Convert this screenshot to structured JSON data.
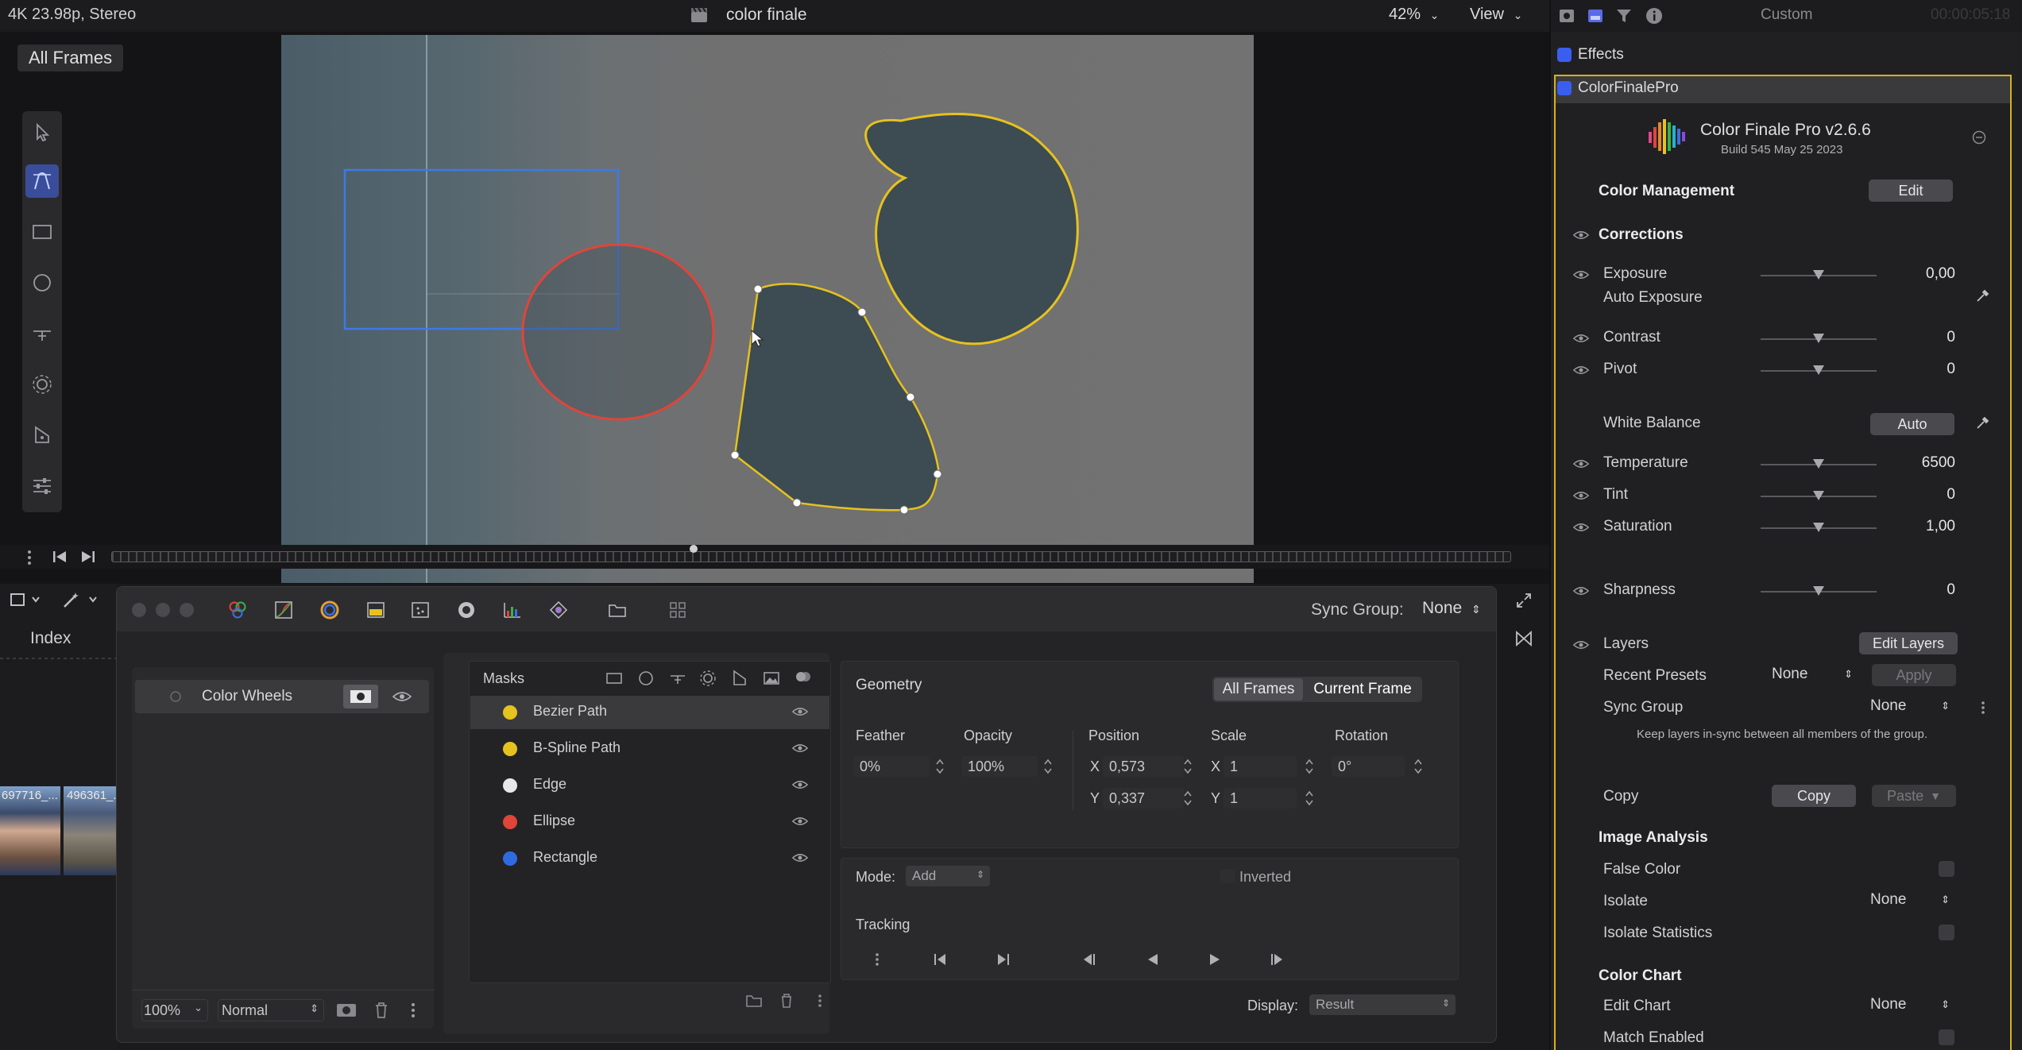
{
  "viewer": {
    "format": "4K 23.98p, Stereo",
    "clip_title": "color finale",
    "zoom": "42%",
    "view_menu": "View",
    "all_frames_badge": "All Frames"
  },
  "inspector_header": {
    "preset": "Custom",
    "timecode": "00:00:05:18"
  },
  "colors": {
    "accent_blue": "#3a5ef0",
    "mask_yellow": "#e6c21e",
    "mask_white": "#e8e8e8",
    "mask_red": "#e0453a",
    "mask_blue": "#2f6be0",
    "selection_yellow": "#d6b21a"
  },
  "bottom_toolbar": {
    "sync_group_label": "Sync Group:",
    "sync_group_value": "None"
  },
  "browser": {
    "index_tab": "Index",
    "thumb1_label": "697716_...",
    "thumb2_label": "496361_..."
  },
  "layers_panel": {
    "layer_name": "Color Wheels",
    "zoom_value": "100%",
    "blend_mode": "Normal"
  },
  "masks": {
    "title": "Masks",
    "items": [
      {
        "label": "Bezier Path",
        "color": "#e6c21e"
      },
      {
        "label": "B-Spline Path",
        "color": "#e6c21e"
      },
      {
        "label": "Edge",
        "color": "#e8e8e8"
      },
      {
        "label": "Ellipse",
        "color": "#e0453a"
      },
      {
        "label": "Rectangle",
        "color": "#2f6be0"
      }
    ]
  },
  "geometry": {
    "title": "Geometry",
    "all_frames": "All Frames",
    "current_frame": "Current Frame",
    "feather_label": "Feather",
    "feather_value": "0%",
    "opacity_label": "Opacity",
    "opacity_value": "100%",
    "position_label": "Position",
    "pos_x_label": "X",
    "pos_x": "0,573",
    "pos_y_label": "Y",
    "pos_y": "0,337",
    "scale_label": "Scale",
    "scale_x_label": "X",
    "scale_x": "1",
    "scale_y_label": "Y",
    "scale_y": "1",
    "rotation_label": "Rotation",
    "rotation_value": "0°",
    "mode_label": "Mode:",
    "mode_value": "Add",
    "inverted_label": "Inverted",
    "tracking_label": "Tracking",
    "display_label": "Display:",
    "display_value": "Result"
  },
  "inspector": {
    "effects_label": "Effects",
    "plugin_label": "ColorFinalePro",
    "product_name": "Color Finale Pro v2.6.6",
    "build": "Build 545 May 25 2023",
    "color_management": "Color Management",
    "edit_button": "Edit",
    "corrections": "Corrections",
    "exposure_label": "Exposure",
    "exposure_value": "0,00",
    "auto_exposure_label": "Auto Exposure",
    "contrast_label": "Contrast",
    "contrast_value": "0",
    "pivot_label": "Pivot",
    "pivot_value": "0",
    "white_balance_label": "White Balance",
    "auto_button": "Auto",
    "temperature_label": "Temperature",
    "temperature_value": "6500",
    "tint_label": "Tint",
    "tint_value": "0",
    "saturation_label": "Saturation",
    "saturation_value": "1,00",
    "sharpness_label": "Sharpness",
    "sharpness_value": "0",
    "layers_label": "Layers",
    "edit_layers_button": "Edit Layers",
    "recent_presets_label": "Recent Presets",
    "recent_presets_value": "None",
    "apply_button": "Apply",
    "sync_group_label": "Sync Group",
    "sync_group_value": "None",
    "sync_note": "Keep layers in-sync between all members of the group.",
    "copy_label": "Copy",
    "copy_button": "Copy",
    "paste_button": "Paste",
    "image_analysis": "Image Analysis",
    "false_color_label": "False Color",
    "isolate_label": "Isolate",
    "isolate_value": "None",
    "isolate_stats_label": "Isolate Statistics",
    "color_chart": "Color Chart",
    "edit_chart_label": "Edit Chart",
    "edit_chart_value": "None",
    "match_enabled_label": "Match Enabled"
  }
}
